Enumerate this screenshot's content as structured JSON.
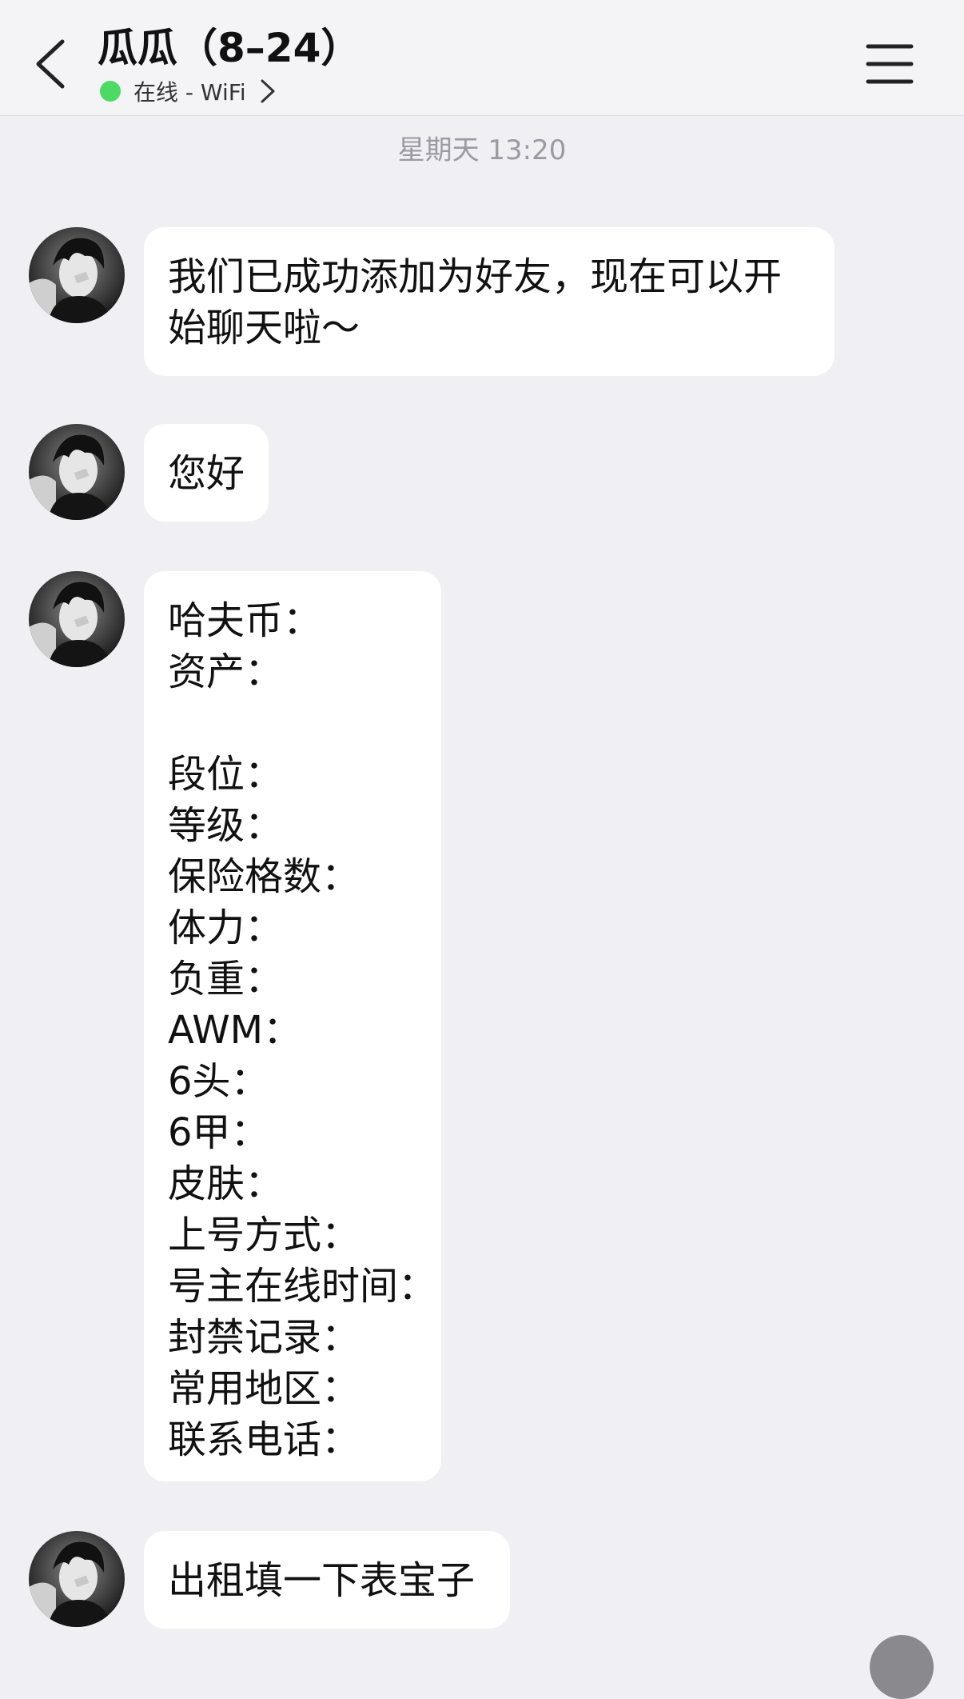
{
  "header": {
    "title": "瓜瓜（8–24）",
    "status": "在线 - WiFi",
    "status_color": "#4cd964",
    "back_icon": "chevron-left-icon",
    "menu_icon": "hamburger-menu-icon"
  },
  "timestamp": "星期天 13:20",
  "messages": [
    {
      "text_line1": "我们已成功添加为好友，现在可以开",
      "text_line2": "始聊天啦～"
    },
    {
      "text": "您好"
    },
    {
      "form_lines": [
        "哈夫币：",
        "资产：",
        "",
        "段位：",
        "等级：",
        "保险格数：",
        "体力：",
        "负重：",
        "AWM：",
        "6头：",
        "6甲：",
        "皮肤：",
        "上号方式：",
        "号主在线时间：",
        "封禁记录：",
        "常用地区：",
        "联系电话："
      ]
    },
    {
      "text": "出租填一下表宝子"
    }
  ]
}
